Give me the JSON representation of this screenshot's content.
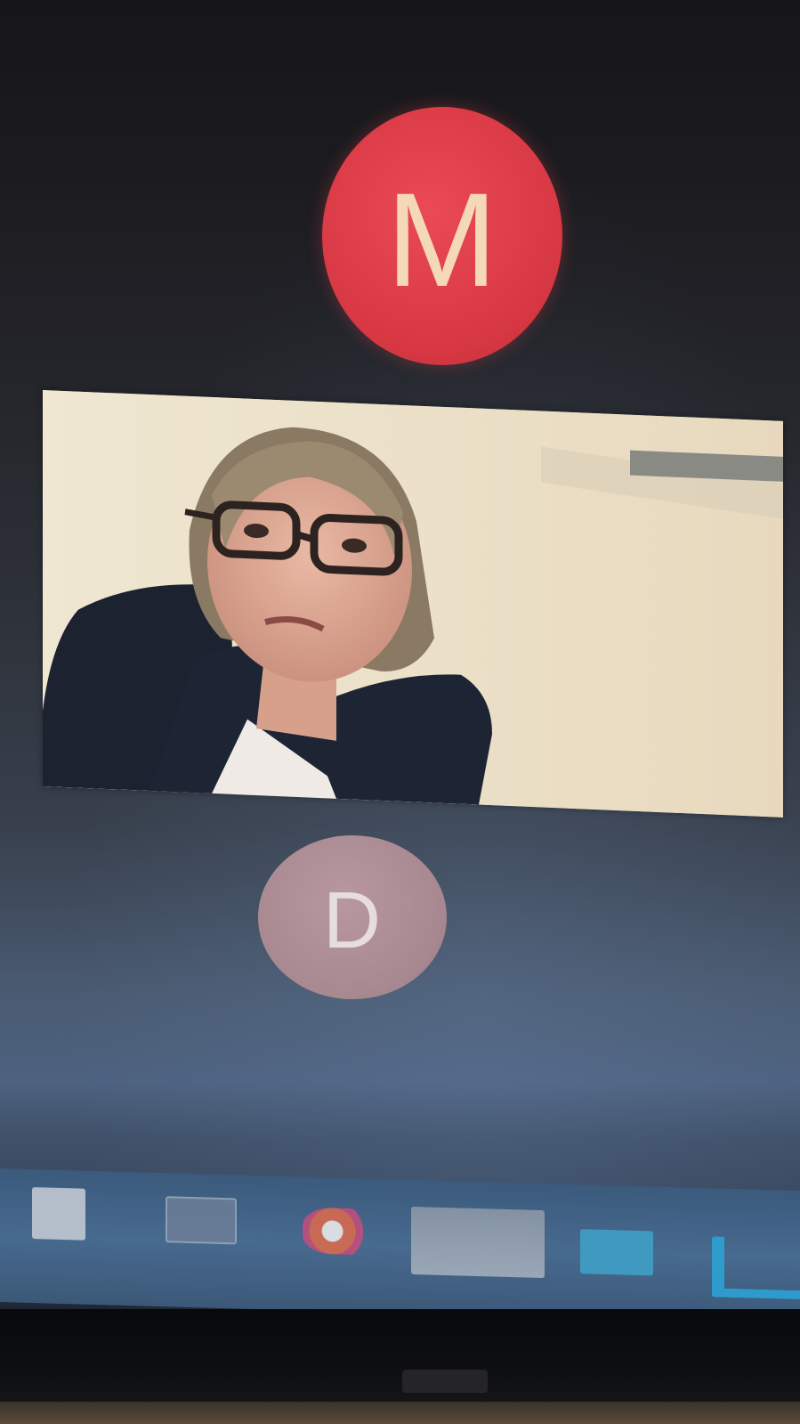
{
  "meeting": {
    "participants": [
      {
        "initial": "M",
        "avatar_color": "#d63742",
        "type": "avatar"
      },
      {
        "initial": "",
        "type": "camera-video"
      },
      {
        "initial": "D",
        "avatar_color": "#a88890",
        "type": "avatar"
      }
    ]
  },
  "taskbar": {
    "icons": [
      {
        "name": "file-explorer-icon",
        "color": "#c9ced6"
      },
      {
        "name": "window-thumbnail-icon",
        "color": "#7d8fa6"
      },
      {
        "name": "app-swirl-icon",
        "color": "#e06a4a"
      },
      {
        "name": "active-window-icon",
        "color": "#9aa6b4"
      },
      {
        "name": "terminal-app-icon",
        "color": "#3fa2c9"
      },
      {
        "name": "vscode-icon",
        "color": "#2aa6d8"
      }
    ]
  }
}
